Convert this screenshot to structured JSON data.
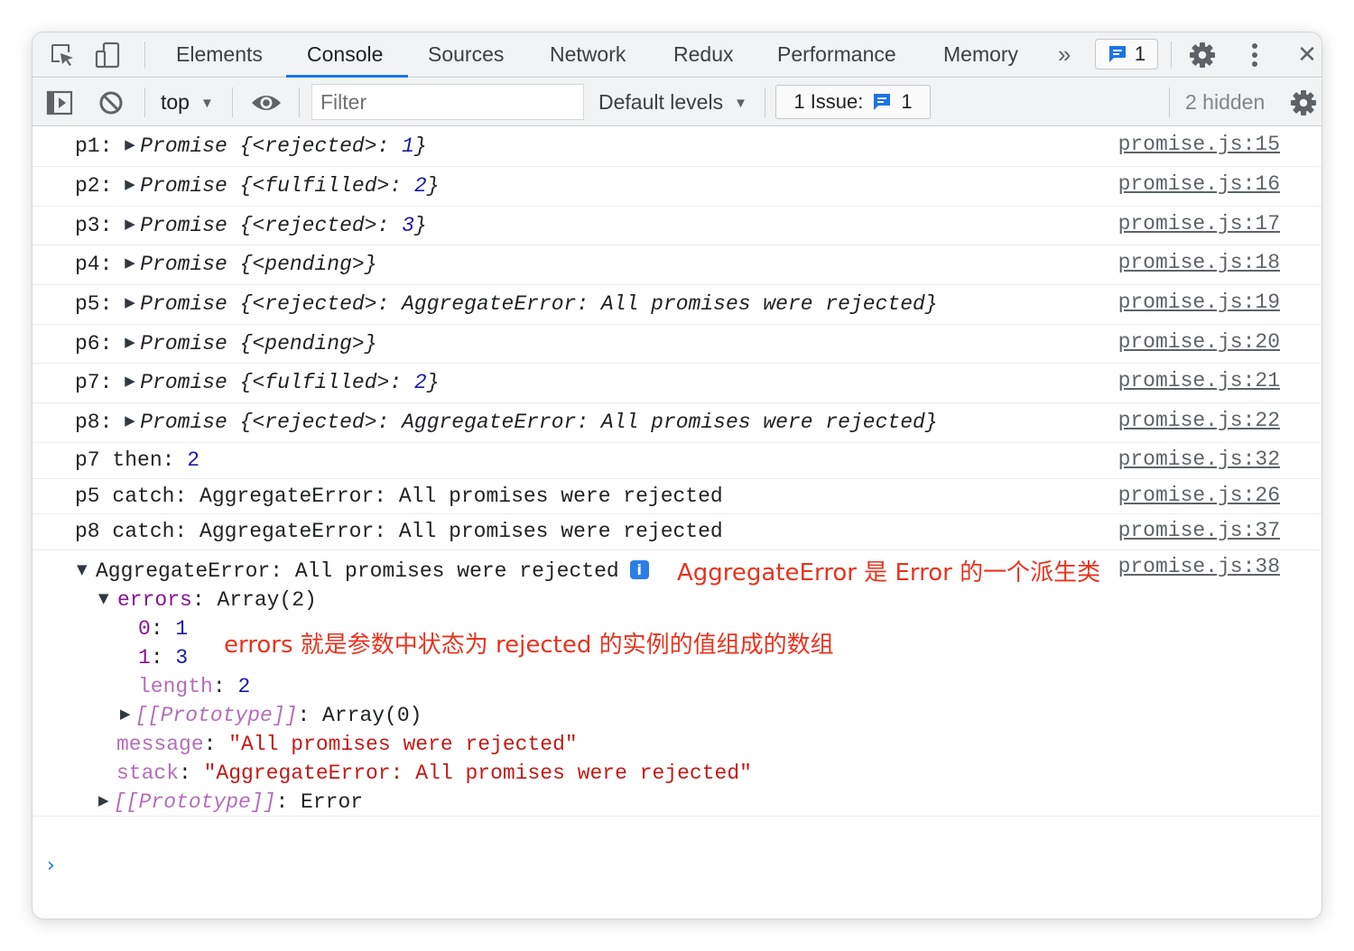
{
  "tabbar": {
    "tabs": [
      {
        "label": "Elements",
        "active": false
      },
      {
        "label": "Console",
        "active": true
      },
      {
        "label": "Sources",
        "active": false
      },
      {
        "label": "Network",
        "active": false
      },
      {
        "label": "Redux",
        "active": false
      },
      {
        "label": "Performance",
        "active": false
      },
      {
        "label": "Memory",
        "active": false
      }
    ],
    "overflow_label": "»",
    "issue_badge_count": "1",
    "close_label": "✕"
  },
  "toolbar": {
    "context": "top",
    "filter_placeholder": "Filter",
    "levels_label": "Default levels",
    "issues_label": "1 Issue:",
    "issues_count": "1",
    "hidden_label": "2 hidden"
  },
  "console": {
    "promise_rows": [
      {
        "label": "p1:",
        "text": "Promise",
        "state": "{<rejected>: ",
        "value": "1",
        "tail": "}",
        "source": "promise.js:15"
      },
      {
        "label": "p2:",
        "text": "Promise",
        "state": "{<fulfilled>: ",
        "value": "2",
        "tail": "}",
        "source": "promise.js:16"
      },
      {
        "label": "p3:",
        "text": "Promise",
        "state": "{<rejected>: ",
        "value": "3",
        "tail": "}",
        "source": "promise.js:17"
      },
      {
        "label": "p4:",
        "text": "Promise",
        "state": "{<pending>}",
        "value": "",
        "tail": "",
        "source": "promise.js:18"
      },
      {
        "label": "p5:",
        "text": "Promise",
        "state": "{<rejected>: AggregateError: All promises were rejected}",
        "value": "",
        "tail": "",
        "source": "promise.js:19"
      },
      {
        "label": "p6:",
        "text": "Promise",
        "state": "{<pending>}",
        "value": "",
        "tail": "",
        "source": "promise.js:20"
      },
      {
        "label": "p7:",
        "text": "Promise",
        "state": "{<fulfilled>: ",
        "value": "2",
        "tail": "}",
        "source": "promise.js:21"
      },
      {
        "label": "p8:",
        "text": "Promise",
        "state": "{<rejected>: AggregateError: All promises were rejected}",
        "value": "",
        "tail": "",
        "source": "promise.js:22"
      }
    ],
    "log_rows": [
      {
        "prefix": "p7 then: ",
        "value": "2",
        "source": "promise.js:32"
      },
      {
        "prefix": "p5 catch: AggregateError: All promises were rejected",
        "value": "",
        "source": "promise.js:26"
      },
      {
        "prefix": "p8 catch: AggregateError: All promises were rejected",
        "value": "",
        "source": "promise.js:37"
      }
    ],
    "expanded": {
      "header": "AggregateError: All promises were rejected",
      "source": "promise.js:38",
      "annotation_1": "AggregateError 是 Error 的一个派生类",
      "errors_key": "errors",
      "errors_value": "Array(2)",
      "items": [
        {
          "key": "0",
          "value": "1"
        },
        {
          "key": "1",
          "value": "3"
        }
      ],
      "length_key": "length",
      "length_value": "2",
      "annotation_2": "errors 就是参数中状态为 rejected 的实例的值组成的数组",
      "array_proto_key": "[[Prototype]]",
      "array_proto_value": "Array(0)",
      "message_key": "message",
      "message_value": "\"All promises were rejected\"",
      "stack_key": "stack",
      "stack_value": "\"AggregateError: All promises were rejected\"",
      "proto_key": "[[Prototype]]",
      "proto_value": "Error"
    },
    "prompt": "›"
  },
  "colors": {
    "accent": "#1a73e8",
    "annotation": "#e8331f",
    "number": "#1a1aa6",
    "string": "#c41a16",
    "property": "#881391"
  }
}
